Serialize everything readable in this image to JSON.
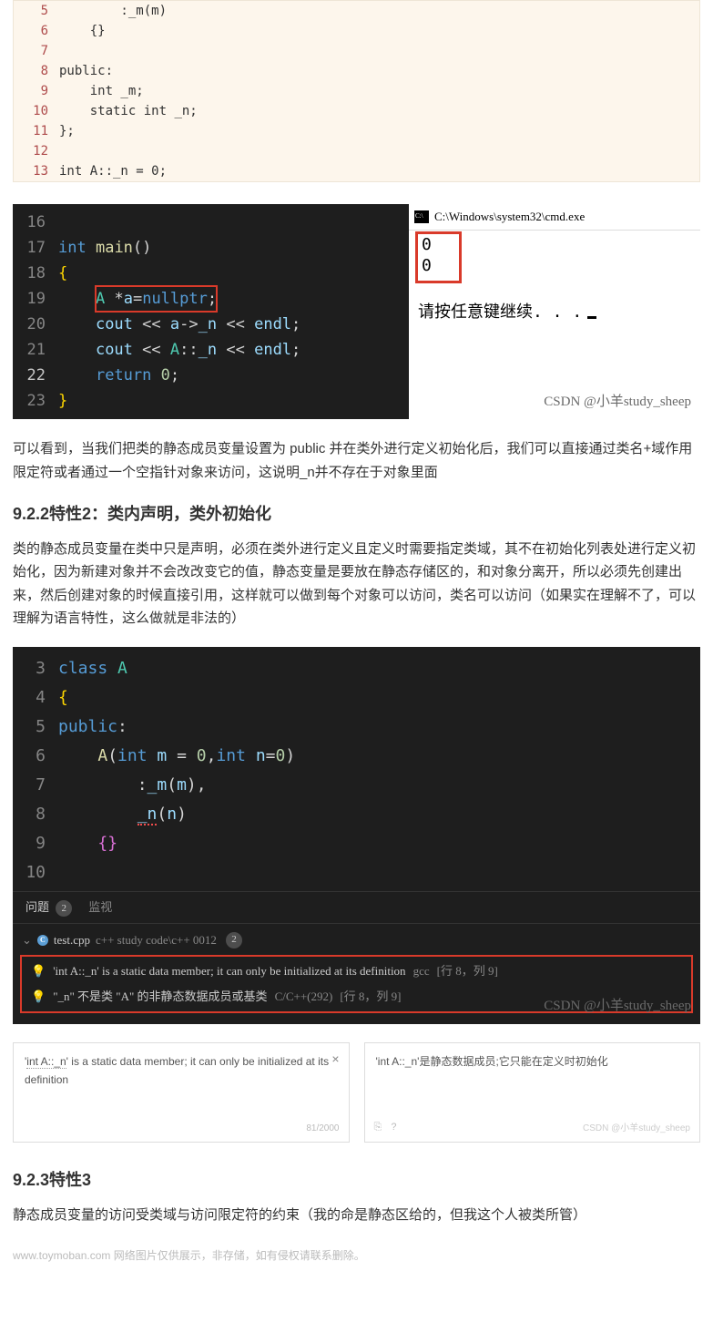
{
  "codeLight": {
    "lines": [
      {
        "n": "5",
        "html": "        :_m(m)"
      },
      {
        "n": "6",
        "html": "    {}"
      },
      {
        "n": "7",
        "html": ""
      },
      {
        "n": "8",
        "html": "<span class='kw'>public</span>:"
      },
      {
        "n": "9",
        "html": "    <span class='ty'>int</span> _m;"
      },
      {
        "n": "10",
        "html": "    <span class='kw'>static</span> <span class='ty'>int</span> _n;"
      },
      {
        "n": "11",
        "html": "};"
      },
      {
        "n": "12",
        "html": ""
      },
      {
        "n": "13",
        "html": "<span class='ty'>int</span> A::_n = <span class='num'>0</span>;"
      }
    ]
  },
  "darkShot1": {
    "lines": [
      {
        "n": "16",
        "cls": "",
        "html": ""
      },
      {
        "n": "17",
        "cls": "",
        "html": "<span class='tok-kw'>int</span> <span class='tok-fn'>main</span>()"
      },
      {
        "n": "18",
        "cls": "",
        "html": "<span class='tok-brace'>{</span>"
      },
      {
        "n": "19",
        "cls": "",
        "html": "    <span class='redbox'><span class='tok-type'>A</span> <span class='tok-op'>*</span><span class='tok-var'>a</span><span class='tok-op'>=</span><span class='tok-null'>nullptr</span>;</span>"
      },
      {
        "n": "20",
        "cls": "",
        "html": "    <span class='tok-var'>cout</span> <span class='tok-op'>&lt;&lt;</span> <span class='tok-var'>a</span><span class='tok-op'>-&gt;</span><span class='tok-var'>_n</span> <span class='tok-op'>&lt;&lt;</span> <span class='tok-var'>endl</span>;"
      },
      {
        "n": "21",
        "cls": "",
        "html": "    <span class='tok-var'>cout</span> <span class='tok-op'>&lt;&lt;</span> <span class='tok-type'>A</span>::<span class='tok-var'>_n</span> <span class='tok-op'>&lt;&lt;</span> <span class='tok-var'>endl</span>;"
      },
      {
        "n": "22",
        "cls": "active",
        "html": "    <span class='tok-kw'>return</span> <span class='tok-num'>0</span>;"
      },
      {
        "n": "23",
        "cls": "",
        "html": "<span class='tok-brace'>}</span>"
      }
    ],
    "cmdTitle": "C:\\Windows\\system32\\cmd.exe",
    "cmdOut1": "0",
    "cmdOut2": "0",
    "cmdPrompt": "请按任意键继续. . .",
    "watermark": "CSDN @小羊study_sheep"
  },
  "para1": "可以看到，当我们把类的静态成员变量设置为 public 并在类外进行定义初始化后，我们可以直接通过类名+域作用限定符或者通过一个空指针对象来访问，这说明_n并不存在于对象里面",
  "heading922": "9.2.2特性2：类内声明，类外初始化",
  "para2": "类的静态成员变量在类中只是声明，必须在类外进行定义且定义时需要指定类域，其不在初始化列表处进行定义初始化，因为新建对象并不会改改变它的值，静态变量是要放在静态存储区的，和对象分离开，所以必须先创建出来，然后创建对象的时候直接引用，这样就可以做到每个对象可以访问，类名可以访问（如果实在理解不了，可以理解为语言特性，这么做就是非法的）",
  "darkShot2": {
    "lines": [
      {
        "n": "3",
        "html": "<span class='tok-kw'>class</span> <span class='tok-type'>A</span>"
      },
      {
        "n": "4",
        "html": "<span class='tok-brace'>{</span>"
      },
      {
        "n": "5",
        "html": "<span class='tok-kw'>public</span>:"
      },
      {
        "n": "6",
        "html": "    <span class='tok-fn'>A</span>(<span class='tok-kw'>int</span> <span class='tok-var'>m</span> <span class='tok-op'>=</span> <span class='tok-num'>0</span>,<span class='tok-kw'>int</span> <span class='tok-var'>n</span><span class='tok-op'>=</span><span class='tok-num'>0</span>)"
      },
      {
        "n": "7",
        "html": "        :<span class='tok-var'>_m</span>(<span class='tok-var'>m</span>),"
      },
      {
        "n": "8",
        "html": "        <span class='tok-var squiggle'>_n</span>(<span class='tok-var'>n</span>)"
      },
      {
        "n": "9",
        "html": "    <span class='tok-brace2'>{}</span>"
      },
      {
        "n": "10",
        "html": ""
      }
    ],
    "tabProblems": "问题",
    "tabProblemsBadge": "2",
    "tabWatch": "监视",
    "fileLabel": "test.cpp",
    "filePath": "c++ study code\\c++  0012",
    "fileBadge": "2",
    "prob1": "'int A::_n' is a static data member; it can only be initialized at its definition",
    "prob1meta": "gcc",
    "prob1loc": "[行 8，列 9]",
    "prob2": "\"_n\" 不是类 \"A\" 的非静态数据成员或基类",
    "prob2meta": "C/C++(292)",
    "prob2loc": "[行 8，列 9]",
    "watermark": "CSDN @小羊study_sheep"
  },
  "card1": {
    "prefix": "'",
    "under": "int A::_n",
    "rest": "' is a static data member; it can only be initialized at its definition",
    "counter": "81/2000"
  },
  "card2": {
    "text": "'int A::_n'是静态数据成员;它只能在定义时初始化",
    "wm": "CSDN @小羊study_sheep"
  },
  "heading923": "9.2.3特性3",
  "para3": "静态成员变量的访问受类域与访问限定符的约束（我的命是静态区给的，但我这个人被类所管）",
  "footer": "www.toymoban.com 网络图片仅供展示，非存储，如有侵权请联系删除。"
}
